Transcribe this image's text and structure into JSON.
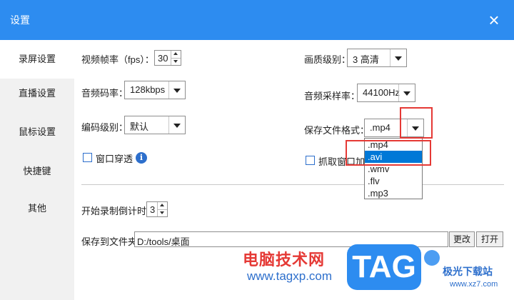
{
  "window": {
    "title": "设置"
  },
  "sidebar": {
    "items": [
      {
        "label": "录屏设置",
        "active": true
      },
      {
        "label": "直播设置",
        "active": false
      },
      {
        "label": "鼠标设置",
        "active": false
      },
      {
        "label": "快捷键",
        "active": false
      },
      {
        "label": "其他",
        "active": false
      }
    ]
  },
  "record": {
    "fps_label": "视频帧率（fps）：",
    "fps_value": "30",
    "quality_label": "画质级别：",
    "quality_value": "3 高清",
    "audio_bitrate_label": "音频码率：",
    "audio_bitrate_value": "128kbps",
    "sample_rate_label": "音频采样率：",
    "sample_rate_value": "44100Hz",
    "encode_label": "编码级别：",
    "encode_value": "默认",
    "format_label": "保存文件格式：",
    "format_value": ".mp4",
    "format_options": [
      ".mp4",
      ".avi",
      ".wmv",
      ".flv",
      ".mp3"
    ],
    "format_highlighted": ".avi",
    "window_through_label": "窗口穿透",
    "capture_window_label": "抓取窗口加透"
  },
  "other": {
    "countdown_label": "开始录制倒计时:",
    "countdown_value": "3",
    "folder_label": "保存到文件夹:",
    "folder_value": "D:/tools/桌面",
    "change_button": "更改",
    "open_button": "打开"
  },
  "watermark": {
    "site_name": "电脑技术网",
    "site_url": "www.tagxp.com",
    "tag_logo": "TAG",
    "site2_name": "极光下载站",
    "site2_url": "www.xz7.com"
  },
  "colors": {
    "titlebar": "#2d8cf0",
    "selection": "#0078d7",
    "annotation": "#e53935"
  }
}
